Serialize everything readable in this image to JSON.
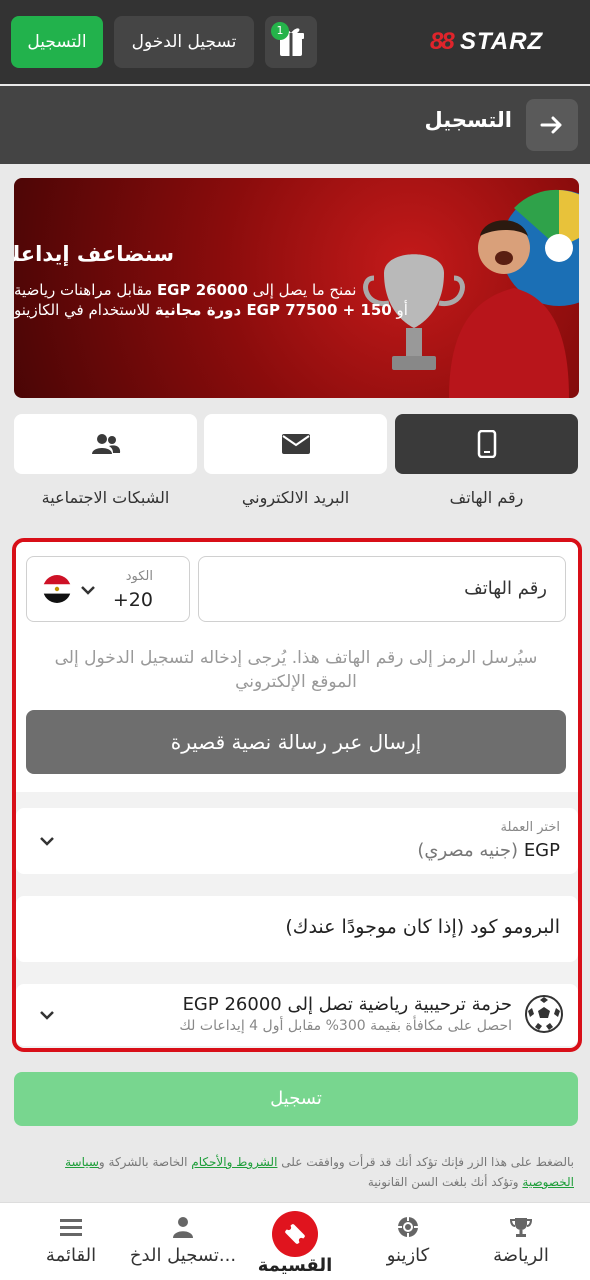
{
  "topbar": {
    "logo_prefix": "88",
    "logo_text": "STARZ",
    "gift_badge": "1",
    "login_label": "تسجيل الدخول",
    "register_label": "التسجيل"
  },
  "page": {
    "title": "التسجيل"
  },
  "banner": {
    "title": "سنضاعف إيداعك",
    "line1_pre": "نمنح ما يصل إلى ",
    "line1_bold": "EGP 26000",
    "line1_post": " مقابل مراهنات رياضية",
    "line2_pre": "أو ",
    "line2_bold1": "EGP 77500 + 150",
    "line2_bold2": " دورة مجانية",
    "line2_post": " للاستخدام في الكازينو"
  },
  "methods": [
    {
      "label": "رقم الهاتف",
      "icon": "phone-icon",
      "active": true
    },
    {
      "label": "البريد الالكتروني",
      "icon": "envelope-icon",
      "active": false
    },
    {
      "label": "الشبكات الاجتماعية",
      "icon": "users-icon",
      "active": false
    }
  ],
  "form": {
    "code_label": "الكود",
    "code_value": "+20",
    "phone_placeholder": "رقم الهاتف",
    "hint": "سيُرسل الرمز إلى رقم الهاتف هذا. يُرجى إدخاله لتسجيل الدخول إلى الموقع الإلكتروني",
    "sms_button": "إرسال عبر رسالة نصية قصيرة",
    "currency_label": "اختر العملة",
    "currency_code": "EGP",
    "currency_name": "(جنيه مصري)",
    "promo_placeholder": "البرومو كود (إذا كان موجودًا عندك)",
    "bonus_title": "حزمة ترحيبية رياضية تصل إلى EGP 26000",
    "bonus_subtitle": "احصل على مكافأة بقيمة 300% مقابل أول 4 إيداعات لك"
  },
  "submit_label": "تسجيل",
  "terms": {
    "pre": "بالضغط على هذا الزر فإنك تؤكد أنك قد قرأت ووافقت على ",
    "link1": "الشروط والأحكام",
    "mid": " الخاصة بالشركة و",
    "link2": "سياسة الخصوصية",
    "post": " وتؤكد أنك بلغت السن القانونية"
  },
  "bottom_nav": [
    {
      "label": "الرياضة",
      "icon": "trophy-icon"
    },
    {
      "label": "كازينو",
      "icon": "chip-icon"
    },
    {
      "label": "القسيمة",
      "icon": "ticket-icon"
    },
    {
      "label": "تسجيل الدخ...",
      "icon": "user-icon"
    },
    {
      "label": "القائمة",
      "icon": "menu-icon"
    }
  ],
  "colors": {
    "accent_green": "#22b24c",
    "brand_red": "#e0242b",
    "form_border": "#d80f18"
  }
}
